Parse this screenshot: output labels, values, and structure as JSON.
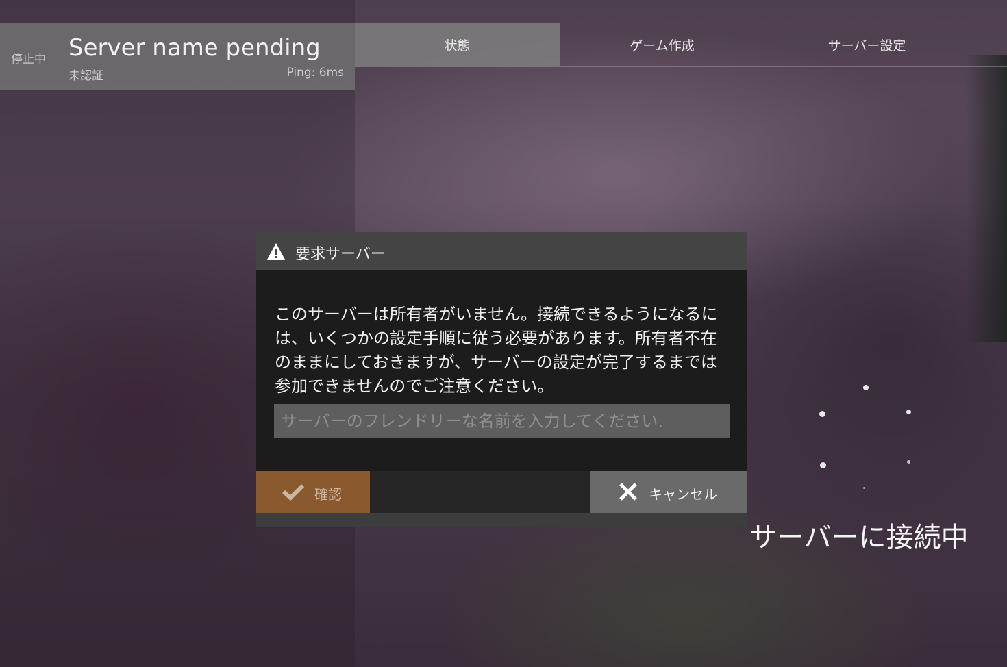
{
  "server": {
    "status": "停止中",
    "name": "Server name pending",
    "auth": "未認証",
    "ping": "Ping: 6ms"
  },
  "tabs": [
    {
      "label": "状態",
      "active": true
    },
    {
      "label": "ゲーム作成",
      "active": false
    },
    {
      "label": "サーバー設定",
      "active": false
    }
  ],
  "dialog": {
    "icon": "warning-icon",
    "title": "要求サーバー",
    "message": "このサーバーは所有者がいません。接続できるようになるには、いくつかの設定手順に従う必要があります。所有者不在のままにしておきますが、サーバーの設定が完了するまでは参加できませんのでご注意ください。",
    "input_placeholder": "サーバーのフレンドリーな名前を入力してください.",
    "input_value": "",
    "confirm_label": "確認",
    "cancel_label": "キャンセル"
  },
  "connecting": {
    "text": "サーバーに接続中",
    "icon": "loading-dots-icon"
  },
  "colors": {
    "confirm": "#8a5a2e",
    "cancel": "#6a6a6a",
    "dialog_header": "#444444",
    "dialog_body": "#1c1c1c"
  }
}
